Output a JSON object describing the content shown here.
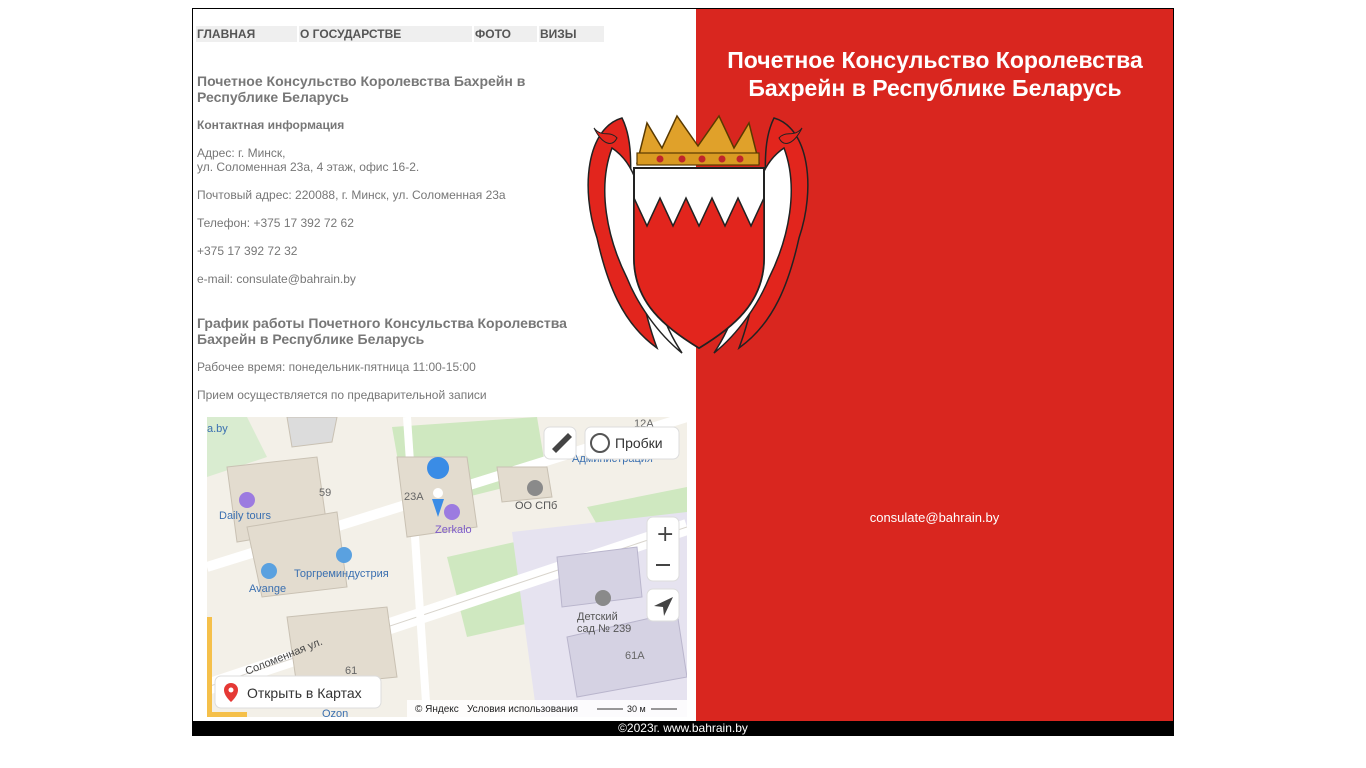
{
  "nav": {
    "items": [
      {
        "label": "ГЛАВНАЯ"
      },
      {
        "label": "О ГОСУДАРСТВЕ"
      },
      {
        "label": "ФОТО"
      },
      {
        "label": "ВИЗЫ"
      }
    ]
  },
  "main": {
    "title": "Почетное Консульство Королевства Бахрейн в Республике Беларусь",
    "contact_heading": "Контактная информация",
    "address_line1": "Адрес: г. Минск,",
    "address_line2": "ул. Соломенная 23а, 4 этаж, офис 16-2.",
    "postal": "Почтовый адрес: 220088, г. Минск, ул. Соломенная 23а",
    "phone1": "Телефон: +375 17 392 72 62",
    "phone2": "+375 17 392 72 32",
    "email_label": "e-mail: ",
    "email": "consulate@bahrain.by",
    "schedule_title": "График работы Почетного Консульства Королевства Бахрейн в Республике Беларусь",
    "hours": "Рабочее время: понедельник-пятница 11:00-15:00",
    "appointment": "Прием осуществляется по предварительной записи"
  },
  "map": {
    "traffic_label": "Пробки",
    "open_maps_label": "Открыть в Картах",
    "yandex_label": "© Яндекс",
    "terms_label": "Условия использования",
    "scale_label": "30 м",
    "places": {
      "daily_tours": "Daily tours",
      "torgremindustriya": "Торгреминдустрия",
      "avange": "Avange",
      "zerkalo": "Zerkalo",
      "oo_spb": "ОО СПб",
      "kindergarten1": "Детский",
      "kindergarten2": "сад № 239",
      "street": "Соломенная ул.",
      "adm": "Администрация",
      "ozon": "Ozon",
      "site_a_by": "a.by",
      "num_59": "59",
      "num_23a": "23А",
      "num_61": "61",
      "num_61a": "61А",
      "num_12a": "12А"
    }
  },
  "right": {
    "title": "Почетное Консульство Королевства Бахрейн в Республике Беларусь",
    "email": "consulate@bahrain.by"
  },
  "footer": {
    "text": "©2023г. www.bahrain.by"
  },
  "colors": {
    "accent_red": "#d9261f",
    "footer_bg": "#000000",
    "text_gray": "#777777"
  }
}
